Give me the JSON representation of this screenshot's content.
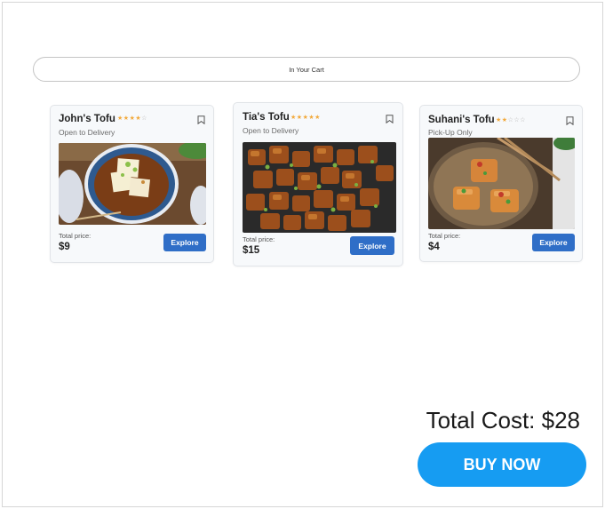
{
  "cart": {
    "label": "In Your Cart"
  },
  "cards": [
    {
      "name": "John's Tofu",
      "rating": 4,
      "max_rating": 5,
      "availability": "Open to Delivery",
      "price_label": "Total price:",
      "price": "$9",
      "button": "Explore",
      "image_subject": "agedashi-tofu-bowl"
    },
    {
      "name": "Tia's Tofu",
      "rating": 5,
      "max_rating": 5,
      "availability": "Open to Delivery",
      "price_label": "Total price:",
      "price": "$15",
      "button": "Explore",
      "image_subject": "crispy-fried-tofu-cubes"
    },
    {
      "name": "Suhani's Tofu",
      "rating": 2,
      "max_rating": 5,
      "availability": "Pick-Up Only",
      "price_label": "Total price:",
      "price": "$4",
      "button": "Explore",
      "image_subject": "tofu-plate-with-chopsticks"
    }
  ],
  "summary": {
    "total": "Total Cost: $28",
    "buy_button": "BUY NOW"
  },
  "colors": {
    "explore_button": "#2f6ec7",
    "buy_button": "#169cf2",
    "star_on": "#f2a93b",
    "star_off": "#b5b5b5"
  }
}
